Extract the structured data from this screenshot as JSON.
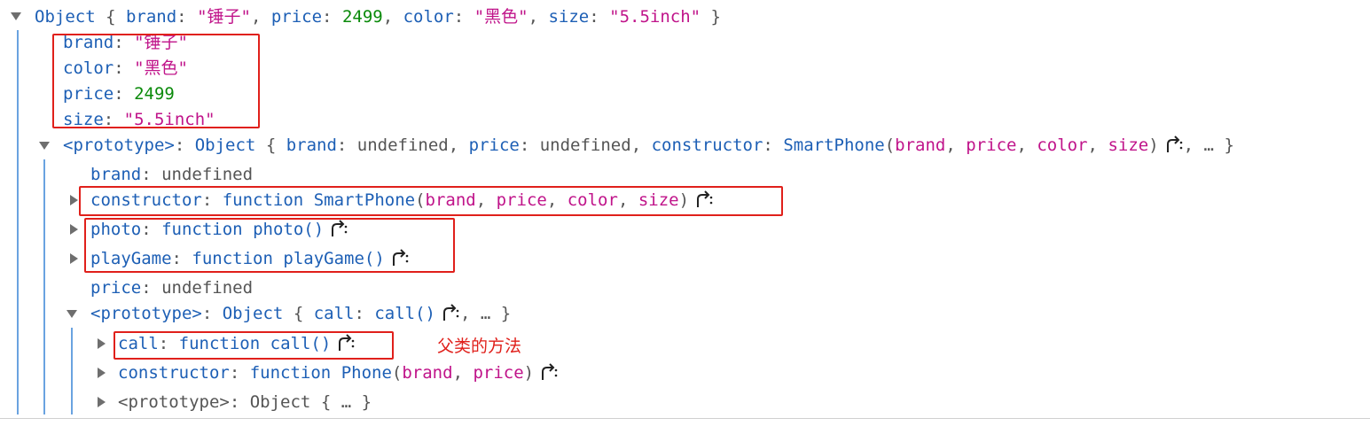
{
  "root": {
    "label": "Object",
    "summary": [
      {
        "key": "brand",
        "value": "\"锤子\"",
        "type": "string"
      },
      {
        "key": "price",
        "value": "2499",
        "type": "number"
      },
      {
        "key": "color",
        "value": "\"黑色\"",
        "type": "string"
      },
      {
        "key": "size",
        "value": "\"5.5inch\"",
        "type": "string"
      }
    ],
    "props": [
      {
        "key": "brand",
        "value": "\"锤子\""
      },
      {
        "key": "color",
        "value": "\"黑色\""
      },
      {
        "key": "price",
        "value": "2499"
      },
      {
        "key": "size",
        "value": "\"5.5inch\""
      }
    ]
  },
  "proto1": {
    "key": "<prototype>",
    "label": "Object",
    "summary_brand_key": "brand",
    "summary_brand_val": "undefined",
    "summary_price_key": "price",
    "summary_price_val": "undefined",
    "summary_ctor_key": "constructor",
    "summary_ctor_name": "SmartPhone",
    "summary_ctor_params": [
      "brand",
      "price",
      "color",
      "size"
    ],
    "ellipsis": "…",
    "brand": {
      "key": "brand",
      "value": "undefined"
    },
    "constructor": {
      "key": "constructor",
      "kw": "function",
      "name": "SmartPhone",
      "params": [
        "brand",
        "price",
        "color",
        "size"
      ]
    },
    "photo": {
      "key": "photo",
      "kw": "function",
      "name": "photo()"
    },
    "playGame": {
      "key": "playGame",
      "kw": "function",
      "name": "playGame()"
    },
    "price": {
      "key": "price",
      "value": "undefined"
    }
  },
  "proto2": {
    "key": "<prototype>",
    "label": "Object",
    "summary_key": "call",
    "summary_val": "call()",
    "ellipsis": "…",
    "call": {
      "key": "call",
      "kw": "function",
      "name": "call()"
    },
    "constructor": {
      "key": "constructor",
      "kw": "function",
      "name": "Phone",
      "params": [
        "brand",
        "price"
      ]
    },
    "proto3": {
      "key": "<prototype>",
      "label": "Object",
      "ellipsis": "…"
    }
  },
  "annotation": "父类的方法",
  "colors": {
    "highlight_box": "#e0201b",
    "key": "#1d5fb5",
    "string": "#c0148a",
    "number": "#0a8a0a",
    "muted": "#555555"
  }
}
